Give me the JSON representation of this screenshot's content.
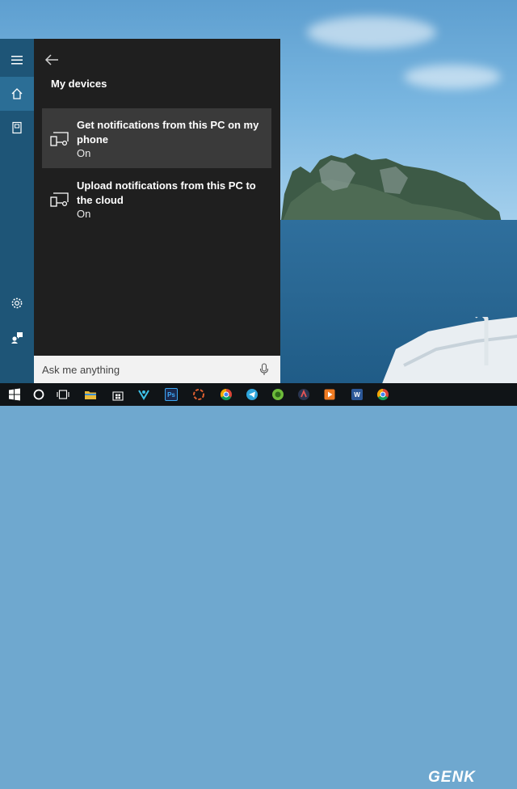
{
  "cortana": {
    "heading": "My devices",
    "devices": [
      {
        "title": "Get notifications from this PC on my phone",
        "status": "On"
      },
      {
        "title": "Upload notifications from this PC to the cloud",
        "status": "On"
      }
    ],
    "ask": {
      "placeholder": "Ask me anything"
    }
  },
  "rail": {
    "items": [
      "hamburger-menu-icon",
      "home-icon",
      "notebook-icon",
      "settings-icon",
      "feedback-icon"
    ]
  },
  "taskbar": {
    "apps": [
      "windows-start-icon",
      "cortana-search-icon",
      "task-view-icon",
      "file-explorer-icon",
      "store-icon",
      "app-icon",
      "photoshop-icon",
      "app-icon",
      "chrome-icon",
      "telegram-icon",
      "app-icon",
      "app-icon",
      "app-icon",
      "word-icon",
      "chrome-icon"
    ],
    "ps_label": "Ps",
    "word_label": "W",
    "watermark": "GENK"
  },
  "colors": {
    "panel_bg": "#1f1f1f",
    "rail_bg": "#1e5577",
    "rail_active": "#2b6e96",
    "card_highlight": "#3a3a3a",
    "taskbar_bg": "#101417"
  }
}
